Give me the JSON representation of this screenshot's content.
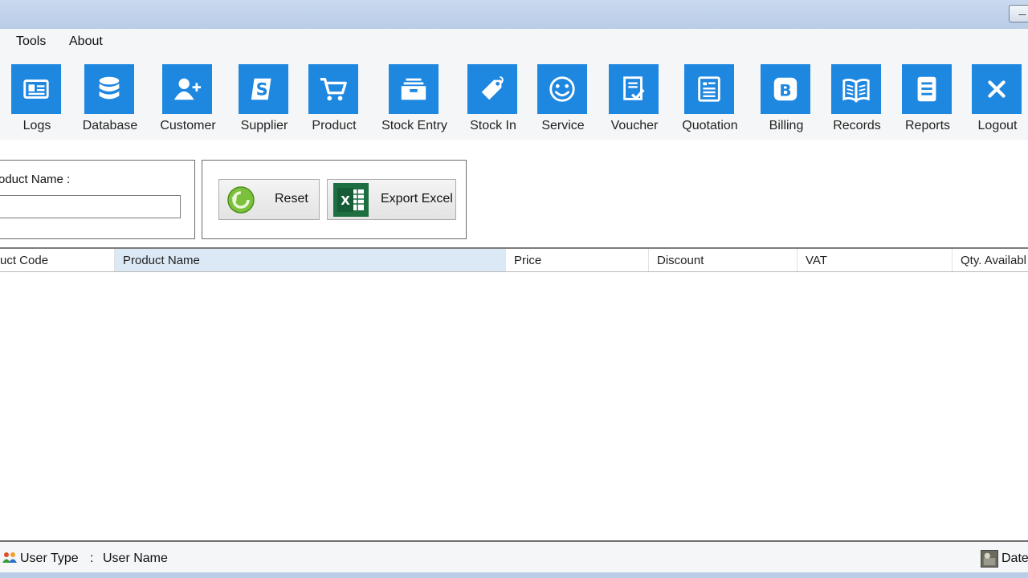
{
  "menu": [
    "Tools",
    "About"
  ],
  "toolbar": {
    "accent": "#1e87e0",
    "items": [
      {
        "label": "Logs",
        "icon": "id-card-icon"
      },
      {
        "label": "Database",
        "icon": "database-icon"
      },
      {
        "label": "Customer",
        "icon": "add-user-icon"
      },
      {
        "label": "Supplier",
        "icon": "supplier-s-icon"
      },
      {
        "label": "Product",
        "icon": "shopping-cart-icon"
      },
      {
        "label": "Stock Entry",
        "icon": "archive-box-icon"
      },
      {
        "label": "Stock In",
        "icon": "price-tag-icon"
      },
      {
        "label": "Service",
        "icon": "smiley-icon"
      },
      {
        "label": "Voucher",
        "icon": "voucher-check-icon"
      },
      {
        "label": "Quotation",
        "icon": "document-list-icon"
      },
      {
        "label": "Billing",
        "icon": "billing-b-icon"
      },
      {
        "label": "Records",
        "icon": "open-book-icon"
      },
      {
        "label": "Reports",
        "icon": "report-icon"
      },
      {
        "label": "Logout",
        "icon": "close-x-icon"
      }
    ]
  },
  "filter": {
    "label": "roduct Name :",
    "value": ""
  },
  "actions": {
    "reset_label": "Reset",
    "export_label": "Export Excel"
  },
  "grid": {
    "columns": [
      "uct Code",
      "Product Name",
      "Price",
      "Discount",
      "VAT",
      "Qty. Availabl"
    ],
    "selected_column": "Product Name",
    "rows": []
  },
  "status": {
    "user_type": "User Type",
    "separator": ":",
    "user_name": "User Name",
    "date": "Date"
  }
}
